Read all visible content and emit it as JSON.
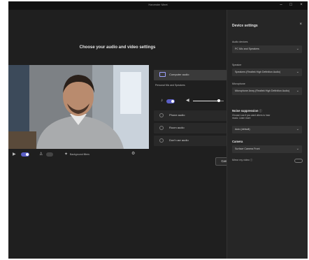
{
  "window": {
    "title": "Harvester Meet"
  },
  "main": {
    "heading": "Choose your audio and video settings",
    "video_toolbar": {
      "bg_filters_label": "Background filters"
    },
    "audio": {
      "computer_audio": "Computer audio",
      "section_label": "Personal Mic and Speakers",
      "phone_audio": "Phone audio",
      "room_audio": "Room audio",
      "dont_use_audio": "Don't use audio",
      "mic_volume_fraction": 0.85
    },
    "cancel_label": "Cancel"
  },
  "sidebar": {
    "title": "Device settings",
    "audio_devices_label": "Audio devices",
    "audio_device_value": "PC Mic and Speakers",
    "speaker_label": "Speaker",
    "speaker_value": "Speakers (Realtek High Definition Audio)",
    "microphone_label": "Microphone",
    "microphone_value": "Microphone Array (Realtek High Definition Audio)",
    "noise_title": "Noise suppression",
    "noise_desc_line1": "Choose Low if you want others to hear",
    "noise_desc_line2": "music. Learn more",
    "noise_value": "Auto (default)",
    "camera_title": "Camera",
    "camera_value": "Surface Camera Front",
    "mirror_label": "Mirror my video"
  },
  "colors": {
    "accent": "#5b5fc7",
    "window_bg": "#1f1f1f",
    "sidebar_bg": "#262626"
  }
}
